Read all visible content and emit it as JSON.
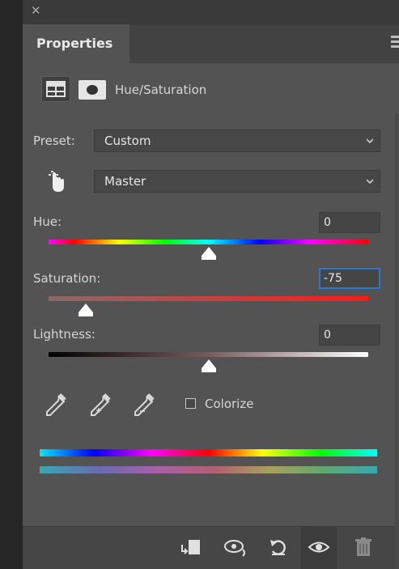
{
  "panel": {
    "title": "Properties",
    "adjustment_name": "Hue/Saturation"
  },
  "preset": {
    "label": "Preset:",
    "value": "Custom"
  },
  "channel": {
    "value": "Master"
  },
  "hue": {
    "label": "Hue:",
    "value": "0",
    "slider_fraction": 0.5
  },
  "saturation": {
    "label": "Saturation:",
    "value": "-75",
    "slider_fraction": 0.125
  },
  "lightness": {
    "label": "Lightness:",
    "value": "0",
    "slider_fraction": 0.5
  },
  "colorize": {
    "label": "Colorize",
    "checked": false
  },
  "footer": {
    "icons": [
      "clip-to-layer-icon",
      "view-previous-state-icon",
      "reset-icon",
      "toggle-visibility-icon",
      "delete-icon"
    ]
  },
  "colors": {
    "panel_bg": "#535353",
    "field_bg": "#454545",
    "focus_border": "#2b78c8"
  }
}
